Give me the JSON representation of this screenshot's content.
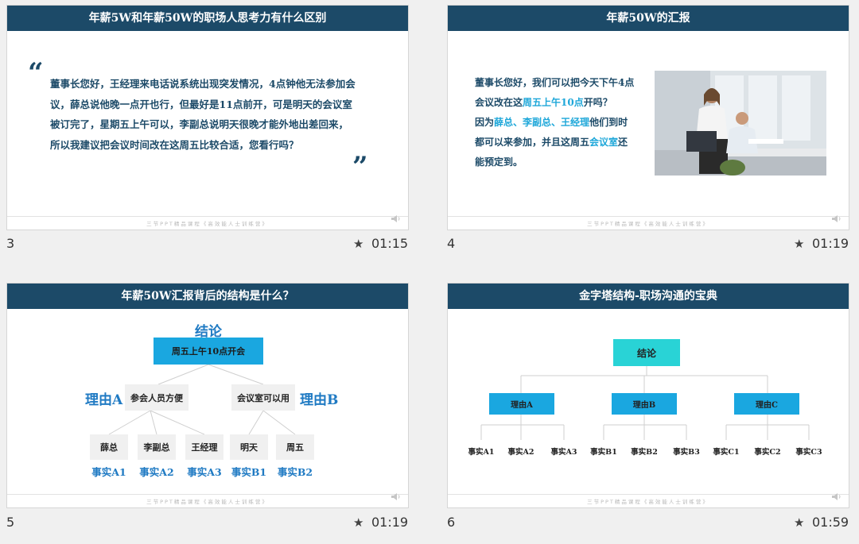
{
  "footer_text": "三节PPT精品课程《高效能人士训练营》",
  "slides": [
    {
      "number": "3",
      "duration": "01:15",
      "title": "年薪5W和年薪50W的职场人思考力有什么区别",
      "open_quote": "“",
      "close_quote": "”",
      "lines": [
        "董事长您好，王经理来电话说系统出现突发情况，4点钟他无法参加会",
        "议，薛总说他晚一点开也行，但最好是11点前开，可是明天的会议室",
        "被订完了，星期五上午可以，李副总说明天很晚才能外地出差回来，",
        "所以我建议把会议时间改在这周五比较合适，您看行吗？"
      ]
    },
    {
      "number": "4",
      "duration": "01:19",
      "title": "年薪50W的汇报",
      "p1_line1": "董事长您好，我们可以把今天下午4点",
      "p1_line2_a": "会议改在这",
      "p1_line2_hl": "周五上午10点",
      "p1_line2_b": "开吗？",
      "p2_line1_a": "因为",
      "p2_line1_hl1": "薛总、李副总",
      "p2_line1_sep": "、",
      "p2_line1_hl2": "王经理",
      "p2_line1_b": "他们到时",
      "p2_line2_a": "都可以来参加，并且这周五",
      "p2_line2_hl": "会议室",
      "p2_line2_b": "还",
      "p2_line3": "能预定到。"
    },
    {
      "number": "5",
      "duration": "01:19",
      "title": "年薪50W汇报背后的结构是什么？",
      "conclusion_label": "结论",
      "conclusion": "周五上午10点开会",
      "reason_a_label": "理由A",
      "reason_b_label": "理由B",
      "reason_a": "参会人员方便",
      "reason_b": "会议室可以用",
      "facts": [
        "薛总",
        "李副总",
        "王经理",
        "明天",
        "周五"
      ],
      "fact_labels": [
        "事实A1",
        "事实A2",
        "事实A3",
        "事实B1",
        "事实B2"
      ]
    },
    {
      "number": "6",
      "duration": "01:59",
      "title": "金字塔结构-职场沟通的宝典",
      "conclusion": "结论",
      "reasons": [
        "理由A",
        "理由B",
        "理由C"
      ],
      "facts": [
        "事实A1",
        "事实A2",
        "事实A3",
        "事实B1",
        "事实B2",
        "事实B3",
        "事实C1",
        "事实C2",
        "事实C3"
      ]
    }
  ],
  "colors": {
    "banner": "#1c4a68",
    "body_text": "#1c4a68",
    "highlight": "#1ea7d9",
    "label_blue": "#1f7ac3",
    "box_blue": "#1aa7e0",
    "box_teal": "#29d3d6",
    "background": "#f0f0f0"
  },
  "icons": [
    "speaker-icon",
    "star-icon",
    "photo-office-meeting"
  ]
}
